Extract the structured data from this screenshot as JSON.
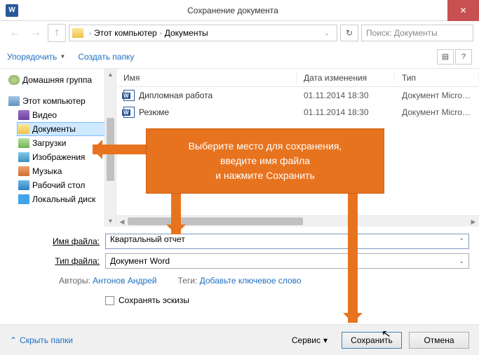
{
  "titlebar": {
    "title": "Сохранение документа",
    "word_glyph": "W",
    "close_glyph": "✕"
  },
  "nav": {
    "back_glyph": "←",
    "fwd_glyph": "→",
    "up_glyph": "↑",
    "refresh_glyph": "↻",
    "crumb1": "Этот компьютер",
    "crumb2": "Документы",
    "sep": "›",
    "search_placeholder": "Поиск: Документы"
  },
  "toolbar": {
    "organize": "Упорядочить",
    "new_folder": "Создать папку",
    "view1_glyph": "▤",
    "view2_glyph": "?"
  },
  "tree": {
    "homegroup": "Домашняя группа",
    "this_pc": "Этот компьютер",
    "video": "Видео",
    "documents": "Документы",
    "downloads": "Загрузки",
    "images": "Изображения",
    "music": "Музыка",
    "desktop": "Рабочий стол",
    "localdisk": "Локальный диск"
  },
  "columns": {
    "name": "Имя",
    "date": "Дата изменения",
    "type": "Тип"
  },
  "files": [
    {
      "name": "Дипломная работа",
      "date": "01.11.2014 18:30",
      "type": "Документ Micros..."
    },
    {
      "name": "Резюме",
      "date": "01.11.2014 18:30",
      "type": "Документ Micros..."
    }
  ],
  "form": {
    "filename_label": "Имя файла:",
    "filename_value": "Квартальный отчет",
    "filetype_label": "Тип файла:",
    "filetype_value": "Документ Word",
    "authors_label": "Авторы:",
    "authors_value": "Антонов Андрей",
    "tags_label": "Теги:",
    "tags_value": "Добавьте ключевое слово",
    "thumbnails": "Сохранять эскизы"
  },
  "footer": {
    "hide_folders": "Скрыть папки",
    "hide_glyph": "⌃",
    "tools": "Сервис",
    "drop": "▾",
    "save": "Сохранить",
    "cancel": "Отмена"
  },
  "callout": {
    "line1": "Выберите место для сохранения,",
    "line2": "введите имя файла",
    "line3": "и нажмите Сохранить"
  }
}
